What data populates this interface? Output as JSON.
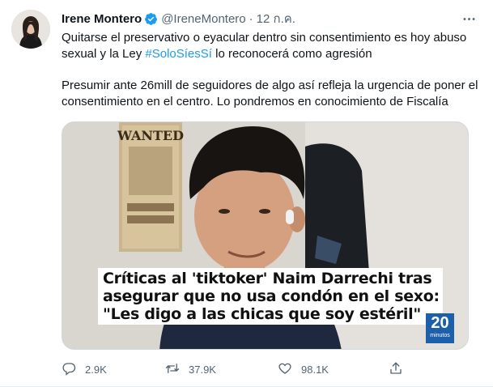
{
  "tweet": {
    "author_name": "Irene Montero",
    "handle": "@IreneMontero",
    "separator": "·",
    "time": "12 ก.ค.",
    "text_line1_before": "Quitarse el preservativo o eyacular dentro sin consentimiento es hoy abuso sexual y la Ley ",
    "hashtag": "#SoloSíesSí",
    "text_line1_after": " lo reconocerá como agresión",
    "text_paragraph2": "Presumir ante 26mill de seguidores de algo así refleja la urgencia de poner el consentimiento en el centro. Lo pondremos en conocimiento de Fiscalía"
  },
  "media": {
    "caption_line1": "Críticas al 'tiktoker' Naim Darrechi tras",
    "caption_line2": "asegurar que no usa condón en el sexo:",
    "caption_line3": "\"Les digo a las chicas que soy estéril\"",
    "logo_number": "20",
    "logo_text": "minutos",
    "poster_text": "WANTED"
  },
  "actions": {
    "reply_count": "2.9K",
    "retweet_count": "37.9K",
    "like_count": "98.1K"
  },
  "colors": {
    "accent": "#1d9bf0",
    "secondary_text": "#536471",
    "logo_blue": "#1d5fa8"
  },
  "icons": [
    "verified-badge-icon",
    "more-icon",
    "reply-icon",
    "retweet-icon",
    "like-icon",
    "share-icon"
  ]
}
